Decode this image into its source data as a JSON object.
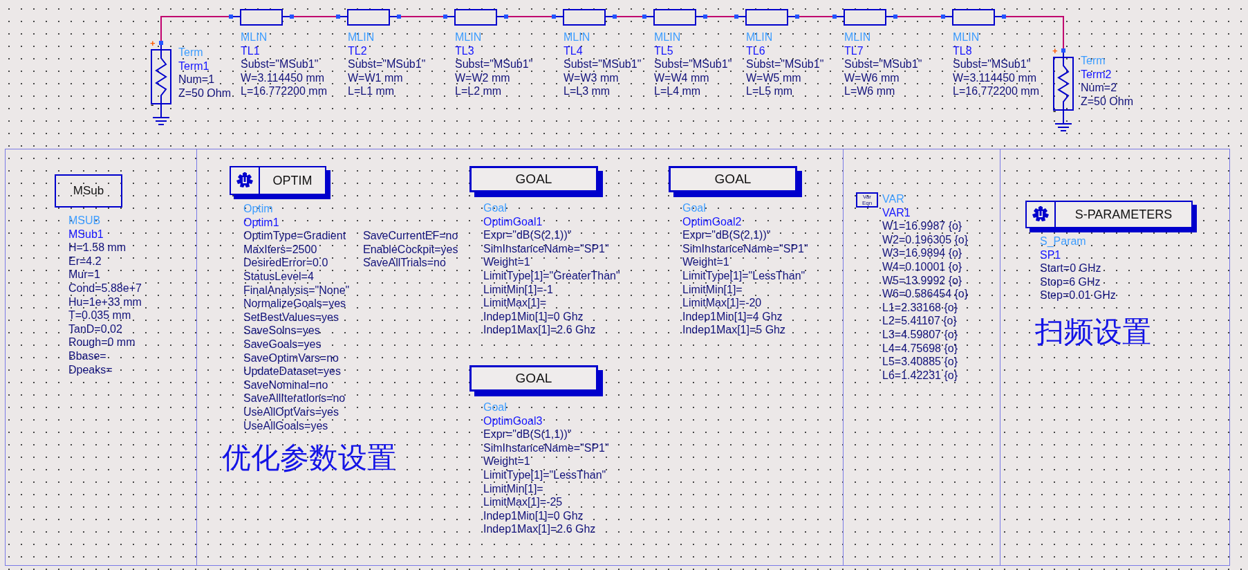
{
  "schematic": {
    "ports": [
      {
        "type": "Term",
        "name": "Term1",
        "plus": "+",
        "minus": "-",
        "params": [
          "Num=1",
          "Z=50 Ohm"
        ]
      },
      {
        "type": "Term",
        "name": "Term2",
        "plus": "+",
        "minus": "-",
        "params": [
          "Num=2",
          "Z=50 Ohm"
        ]
      }
    ],
    "transmission_lines": [
      {
        "type": "MLIN",
        "name": "TL1",
        "params": [
          "Subst=\"MSub1\"",
          "W=3.114450 mm",
          "L=16.772200 mm"
        ]
      },
      {
        "type": "MLIN",
        "name": "TL2",
        "params": [
          "Subst=\"MSub1\"",
          "W=W1 mm",
          "L=L1 mm"
        ]
      },
      {
        "type": "MLIN",
        "name": "TL3",
        "params": [
          "Subst=\"MSub1\"",
          "W=W2 mm",
          "L=L2 mm"
        ]
      },
      {
        "type": "MLIN",
        "name": "TL4",
        "params": [
          "Subst=\"MSub1\"",
          "W=W3 mm",
          "L=L3 mm"
        ]
      },
      {
        "type": "MLIN",
        "name": "TL5",
        "params": [
          "Subst=\"MSub1\"",
          "W=W4 mm",
          "L=L4 mm"
        ]
      },
      {
        "type": "MLIN",
        "name": "TL6",
        "params": [
          "Subst=\"MSub1\"",
          "W=W5 mm",
          "L=L5 mm"
        ]
      },
      {
        "type": "MLIN",
        "name": "TL7",
        "params": [
          "Subst=\"MSub1\"",
          "W=W6 mm",
          "L=W6 mm"
        ]
      },
      {
        "type": "MLIN",
        "name": "TL8",
        "params": [
          "Subst=\"MSub1\"",
          "W=3.114450 mm",
          "L=16.772200 mm"
        ]
      }
    ]
  },
  "substrate": {
    "symbol": "MSub",
    "type": "MSUB",
    "name": "MSub1",
    "params": [
      "H=1.58 mm",
      "Er=4.2",
      "Mur=1",
      "Cond=5.88e+7",
      "Hu=1e+33 mm",
      "T=0.035 mm",
      "TanD=0.02",
      "Rough=0 mm",
      "Bbase=",
      "Dpeaks="
    ]
  },
  "optimizer": {
    "symbol": "OPTIM",
    "type": "Optim",
    "name": "Optim1",
    "params": [
      "OptimType=Gradient",
      "MaxIters=2500",
      "DesiredError=0.0",
      "StatusLevel=4",
      "FinalAnalysis=\"None\"",
      "NormalizeGoals=yes",
      "SetBestValues=yes",
      "SaveSolns=yes",
      "SaveGoals=yes",
      "SaveOptimVars=no",
      "UpdateDataset=yes",
      "SaveNominal=no",
      "SaveAllIterations=no",
      "UseAllOptVars=yes",
      "UseAllGoals=yes"
    ],
    "params_column_2": [
      "SaveCurrentEF=no",
      "EnableCockpit=yes",
      "SaveAllTrials=no"
    ]
  },
  "goals": [
    {
      "symbol": "GOAL",
      "type": "Goal",
      "name": "OptimGoal1",
      "params": [
        "Expr=\"dB(S(2,1))\"",
        "SimInstanceName=\"SP1\"",
        "Weight=1",
        "LimitType[1]=\"GreaterThan\"",
        "LimitMin[1]=-1",
        "LimitMax[1]=",
        "Indep1Min[1]=0 Ghz",
        "Indep1Max[1]=2.6 Ghz"
      ]
    },
    {
      "symbol": "GOAL",
      "type": "Goal",
      "name": "OptimGoal2",
      "params": [
        "Expr=\"dB(S(2,1))\"",
        "SimInstanceName=\"SP1\"",
        "Weight=1",
        "LimitType[1]=\"LessThan\"",
        "LimitMin[1]=",
        "LimitMax[1]=-20",
        "Indep1Min[1]=4 Ghz",
        "Indep1Max[1]=5 Ghz"
      ]
    },
    {
      "symbol": "GOAL",
      "type": "Goal",
      "name": "OptimGoal3",
      "params": [
        "Expr=\"dB(S(1,1))\"",
        "SimInstanceName=\"SP1\"",
        "Weight=1",
        "LimitType[1]=\"LessThan\"",
        "LimitMin[1]=",
        "LimitMax[1]=-25",
        "Indep1Min[1]=0 Ghz",
        "Indep1Max[1]=2.6 Ghz"
      ]
    }
  ],
  "optimizer_note": "优化参数设置",
  "variables": {
    "symbol_lines": [
      "Var",
      "Eqn"
    ],
    "type": "VAR",
    "name": "VAR1",
    "params": [
      "W1=16.9987 {o}",
      "W2=0.196305 {o}",
      "W3=16.9894 {o}",
      "W4=0.10001 {o}",
      "W5=13.9992 {o}",
      "W6=0.586454 {o}",
      "L1=2.33168 {o}",
      "L2=5.41107 {o}",
      "L3=4.59807 {o}",
      "L4=4.75698 {o}",
      "L5=3.40885 {o}",
      "L6=1.42231 {o}"
    ]
  },
  "simulation": {
    "symbol": "S-PARAMETERS",
    "type": "S_Param",
    "name": "SP1",
    "params": [
      "Start=0 GHz",
      "Stop=6 GHz",
      "Step=0.01 GHz"
    ]
  },
  "simulation_note": "扫频设置"
}
